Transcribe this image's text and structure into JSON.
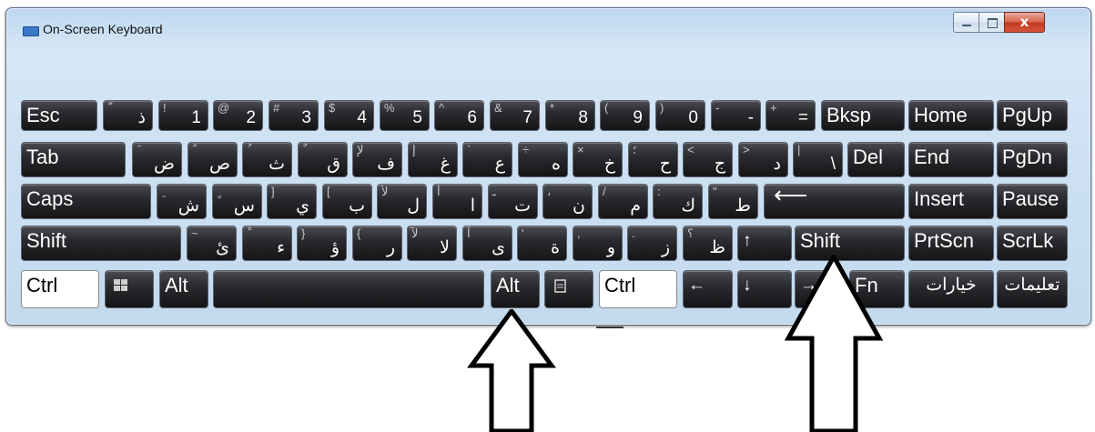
{
  "window": {
    "title": "On-Screen Keyboard",
    "accent": "#3b78c8"
  },
  "keys": {
    "esc": "Esc",
    "bksp": "Bksp",
    "home": "Home",
    "pgup": "PgUp",
    "tab": "Tab",
    "del": "Del",
    "end": "End",
    "pgdn": "PgDn",
    "caps": "Caps",
    "insert": "Insert",
    "pause": "Pause",
    "shift_left": "Shift",
    "shift_right": "Shift",
    "prtscn": "PrtScn",
    "scrlk": "ScrLk",
    "ctrl_left": "Ctrl",
    "alt_left": "Alt",
    "alt_right": "Alt",
    "ctrl_right": "Ctrl",
    "fn": "Fn",
    "options": "خيارات",
    "help": "تعليمات",
    "up": "↑",
    "down": "↓",
    "left": "←",
    "right": "→",
    "enter": "⟵"
  },
  "row1": [
    {
      "s": "ّ",
      "m": "ذ"
    },
    {
      "s": "!",
      "m": "1"
    },
    {
      "s": "@",
      "m": "2"
    },
    {
      "s": "#",
      "m": "3"
    },
    {
      "s": "$",
      "m": "4"
    },
    {
      "s": "%",
      "m": "5"
    },
    {
      "s": "^",
      "m": "6"
    },
    {
      "s": "&",
      "m": "7"
    },
    {
      "s": "*",
      "m": "8"
    },
    {
      "s": "(",
      "m": "9"
    },
    {
      "s": ")",
      "m": "0"
    },
    {
      "s": "-",
      "m": "-"
    },
    {
      "s": "+",
      "m": "="
    }
  ],
  "row2": [
    {
      "s": "َ",
      "m": "ض"
    },
    {
      "s": "ً",
      "m": "ص"
    },
    {
      "s": "ُ",
      "m": "ث"
    },
    {
      "s": "ٌ",
      "m": "ق"
    },
    {
      "s": "لإ",
      "m": "ف"
    },
    {
      "s": "إ",
      "m": "غ"
    },
    {
      "s": "`",
      "m": "ع"
    },
    {
      "s": "÷",
      "m": "ه"
    },
    {
      "s": "×",
      "m": "خ"
    },
    {
      "s": "؛",
      "m": "ح"
    },
    {
      "s": "<",
      "m": "ج"
    },
    {
      "s": ">",
      "m": "د"
    },
    {
      "s": "|",
      "m": "\\"
    }
  ],
  "row3": [
    {
      "s": "ِ",
      "m": "ش"
    },
    {
      "s": "ٍ",
      "m": "س"
    },
    {
      "s": "]",
      "m": "ي"
    },
    {
      "s": "[",
      "m": "ب"
    },
    {
      "s": "لأ",
      "m": "ل"
    },
    {
      "s": "أ",
      "m": "ا"
    },
    {
      "s": "ـ",
      "m": "ت"
    },
    {
      "s": "،",
      "m": "ن"
    },
    {
      "s": "/",
      "m": "م"
    },
    {
      "s": ":",
      "m": "ك"
    },
    {
      "s": "\"",
      "m": "ط"
    }
  ],
  "row4": [
    {
      "s": "~",
      "m": "ئ"
    },
    {
      "s": "ْ",
      "m": "ء"
    },
    {
      "s": "}",
      "m": "ؤ"
    },
    {
      "s": "{",
      "m": "ر"
    },
    {
      "s": "لآ",
      "m": "لا"
    },
    {
      "s": "آ",
      "m": "ى"
    },
    {
      "s": "'",
      "m": "ة"
    },
    {
      "s": ",",
      "m": "و"
    },
    {
      "s": ".",
      "m": "ز"
    },
    {
      "s": "؟",
      "m": "ظ"
    }
  ]
}
